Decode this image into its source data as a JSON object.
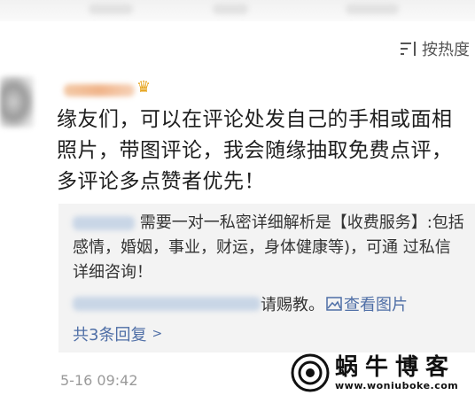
{
  "sort": {
    "label": "按热度"
  },
  "comment": {
    "text": "缘友们，可以在评论处发自己的手相或面相照片，带图评论，我会随缘抽取免费点评，多评论多点赞者优先！"
  },
  "replies": {
    "first_text": "需要一对一私密详细解析是【收费服务】:包括感情，婚姻，事业，财运，身体健康等)，可通 过私信详细咨询！",
    "second_text": "请赐教。",
    "view_image_label": "查看图片",
    "more_label": "共3条回复"
  },
  "timestamp": "5-16 09:42",
  "watermark": {
    "brand": "蜗牛博客",
    "url": "www.woniuboke.com"
  }
}
